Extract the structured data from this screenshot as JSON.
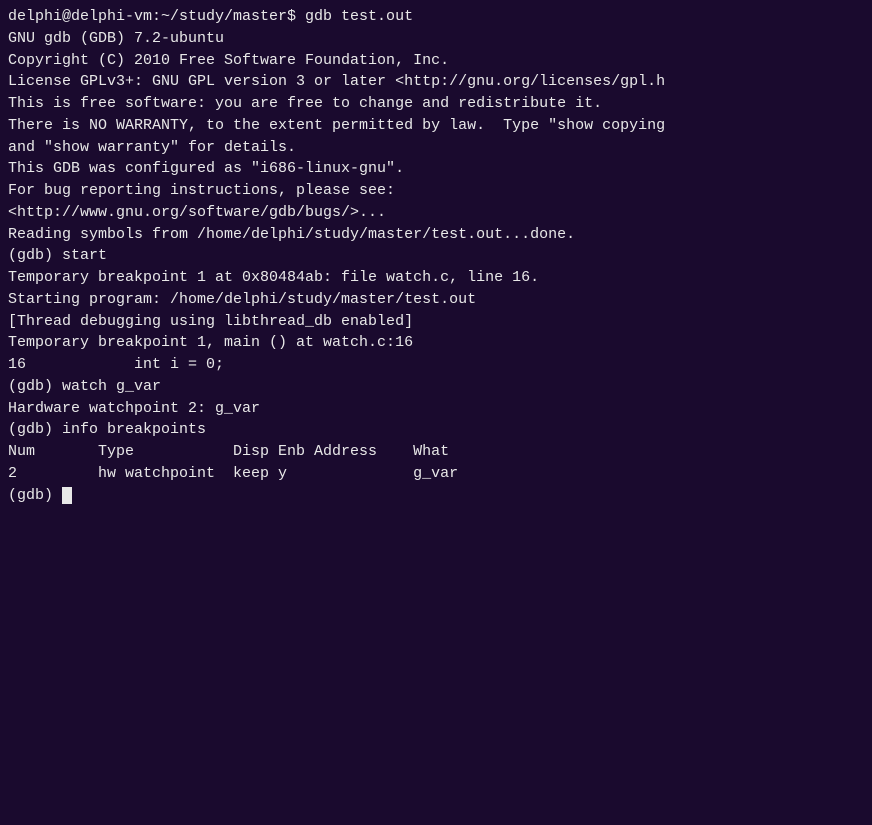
{
  "terminal": {
    "lines": [
      "delphi@delphi-vm:~/study/master$ gdb test.out",
      "GNU gdb (GDB) 7.2-ubuntu",
      "Copyright (C) 2010 Free Software Foundation, Inc.",
      "License GPLv3+: GNU GPL version 3 or later <http://gnu.org/licenses/gpl.h",
      "This is free software: you are free to change and redistribute it.",
      "There is NO WARRANTY, to the extent permitted by law.  Type \"show copying",
      "and \"show warranty\" for details.",
      "This GDB was configured as \"i686-linux-gnu\".",
      "For bug reporting instructions, please see:",
      "<http://www.gnu.org/software/gdb/bugs/>...",
      "Reading symbols from /home/delphi/study/master/test.out...done.",
      "(gdb) start",
      "Temporary breakpoint 1 at 0x80484ab: file watch.c, line 16.",
      "Starting program: /home/delphi/study/master/test.out",
      "[Thread debugging using libthread_db enabled]",
      "",
      "Temporary breakpoint 1, main () at watch.c:16",
      "16            int i = 0;",
      "(gdb) watch g_var",
      "Hardware watchpoint 2: g_var",
      "(gdb) info breakpoints",
      "Num       Type           Disp Enb Address    What",
      "2         hw watchpoint  keep y              g_var",
      "(gdb) "
    ],
    "cursor_visible": true
  }
}
